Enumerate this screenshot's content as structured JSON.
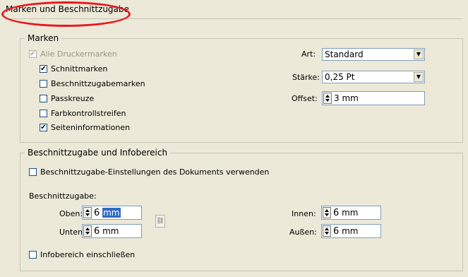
{
  "page_title": "Marken und Beschnittzugabe",
  "marken": {
    "legend": "Marken",
    "options": [
      {
        "label": "Alle Druckermarken",
        "checked": true,
        "disabled": true
      },
      {
        "label": "Schnittmarken",
        "checked": true,
        "disabled": false
      },
      {
        "label": "Beschnittzugabemarken",
        "checked": false,
        "disabled": false
      },
      {
        "label": "Passkreuze",
        "checked": false,
        "disabled": false
      },
      {
        "label": "Farbkontrollstreifen",
        "checked": false,
        "disabled": false
      },
      {
        "label": "Seiteninformationen",
        "checked": true,
        "disabled": false
      }
    ],
    "art_label": "Art:",
    "art_value": "Standard",
    "staerke_label": "Stärke:",
    "staerke_value": "0,25 Pt",
    "offset_label": "Offset:",
    "offset_value": "3 mm"
  },
  "beschnitt": {
    "legend": "Beschnittzugabe und Infobereich",
    "use_doc_settings_label": "Beschnittzugabe-Einstellungen des Dokuments verwenden",
    "use_doc_settings_checked": false,
    "section_label": "Beschnittzugabe:",
    "oben_label": "Oben:",
    "oben_num": "6",
    "oben_unit": "mm",
    "unten_label": "Unten:",
    "unten_num": "6",
    "unten_unit": "mm",
    "innen_label": "Innen:",
    "innen_num": "6",
    "innen_unit": "mm",
    "aussen_label": "Außen:",
    "aussen_num": "6",
    "aussen_unit": "mm",
    "info_label": "Infobereich einschließen",
    "info_checked": false
  },
  "colors": {
    "panel_bg": "#ece9d8",
    "highlight_oval": "#e8161f",
    "selection": "#316ac5"
  },
  "icons": {
    "check": "✔",
    "dropdown": "▼",
    "chain": "chain-link-icon"
  }
}
